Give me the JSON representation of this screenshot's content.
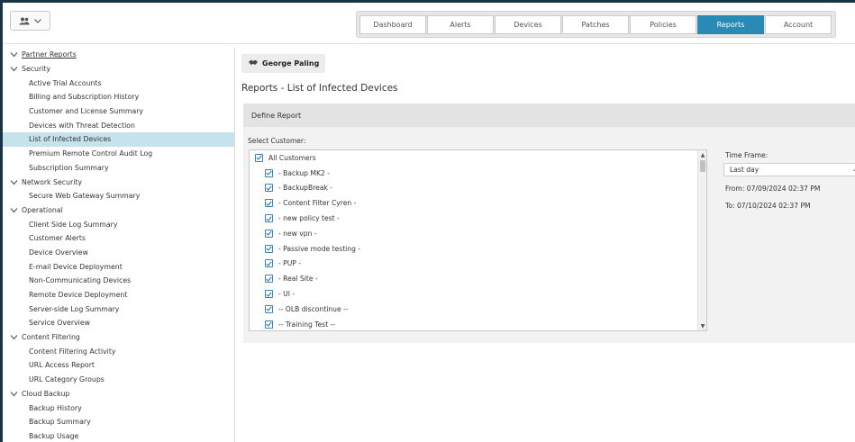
{
  "nav": {
    "tabs": [
      {
        "label": "Dashboard",
        "active": false
      },
      {
        "label": "Alerts",
        "active": false
      },
      {
        "label": "Devices",
        "active": false
      },
      {
        "label": "Patches",
        "active": false
      },
      {
        "label": "Policies",
        "active": false
      },
      {
        "label": "Reports",
        "active": true
      },
      {
        "label": "Account",
        "active": false
      }
    ],
    "active_color": "#2b8ab3"
  },
  "user_switch": {
    "icon": "users-icon",
    "chevron": "chevron-down-icon"
  },
  "sidebar": {
    "root": "Partner Reports",
    "groups": [
      {
        "label": "Security",
        "items": [
          "Active Trial Accounts",
          "Billing and Subscription History",
          "Customer and License Summary",
          "Devices with Threat Detection",
          "List of Infected Devices",
          "Premium Remote Control Audit Log",
          "Subscription Summary"
        ]
      },
      {
        "label": "Network Security",
        "items": [
          "Secure Web Gateway Summary"
        ]
      },
      {
        "label": "Operational",
        "items": [
          "Client Side Log Summary",
          "Customer Alerts",
          "Device Overview",
          "E-mail Device Deployment",
          "Non-Communicating Devices",
          "Remote Device Deployment",
          "Server-side Log Summary",
          "Service Overview"
        ]
      },
      {
        "label": "Content Filtering",
        "items": [
          "Content Filtering Activity",
          "URL Access Report",
          "URL Category Groups"
        ]
      },
      {
        "label": "Cloud Backup",
        "items": [
          "Backup History",
          "Backup Summary",
          "Backup Usage"
        ]
      }
    ],
    "selected": "List of Infected Devices",
    "selected_color": "#c5e2ed"
  },
  "main": {
    "customer_name": "George Paling",
    "page_title": "Reports - List of Infected Devices",
    "define_title": "Define Report",
    "select_customer_label": "Select Customer:",
    "customers": [
      {
        "label": "All Customers",
        "checked": true,
        "level": 0
      },
      {
        "label": "- Backup MK2 -",
        "checked": true,
        "level": 1
      },
      {
        "label": "- BackupBreak -",
        "checked": true,
        "level": 1
      },
      {
        "label": "- Content Filter Cyren -",
        "checked": true,
        "level": 1
      },
      {
        "label": "- new policy test -",
        "checked": true,
        "level": 1
      },
      {
        "label": "- new vpn -",
        "checked": true,
        "level": 1
      },
      {
        "label": "- Passive mode testing -",
        "checked": true,
        "level": 1
      },
      {
        "label": "- PUP -",
        "checked": true,
        "level": 1
      },
      {
        "label": "- Real Site -",
        "checked": true,
        "level": 1
      },
      {
        "label": "- UI -",
        "checked": true,
        "level": 1
      },
      {
        "label": "-- OLB discontinue --",
        "checked": true,
        "level": 1
      },
      {
        "label": "-- Training Test --",
        "checked": true,
        "level": 1
      }
    ],
    "time_frame": {
      "label": "Time Frame:",
      "value": "Last day",
      "from": "From: 07/09/2024 02:37 PM",
      "to": "To: 07/10/2024 02:37 PM"
    }
  }
}
